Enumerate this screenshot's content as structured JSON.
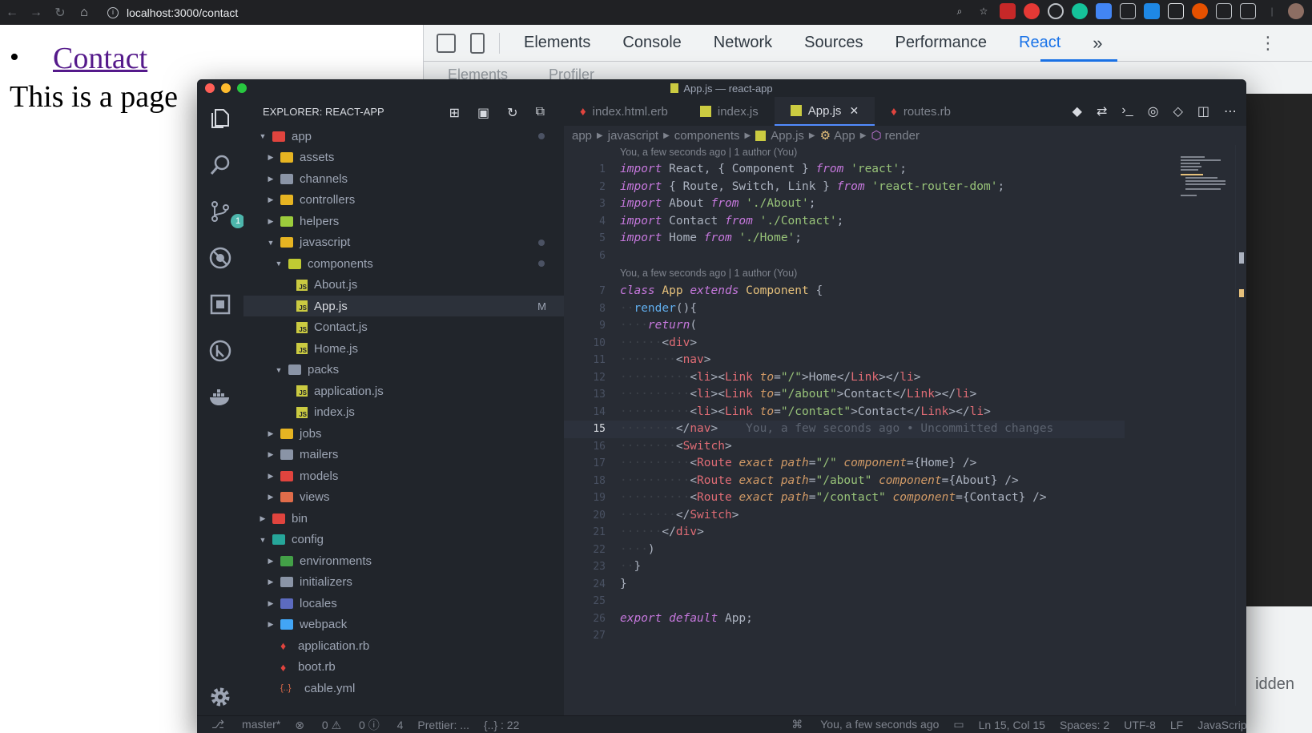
{
  "browser": {
    "url": "localhost:3000/contact"
  },
  "page": {
    "link_text": "Contact",
    "paragraph": "This is a page"
  },
  "devtools": {
    "tabs": [
      "Elements",
      "Console",
      "Network",
      "Sources",
      "Performance",
      "React"
    ],
    "more": "»",
    "subtabs": [
      "Elements",
      "Profiler"
    ],
    "hidden_label": "idden"
  },
  "vscode": {
    "title": "App.js — react-app",
    "explorer_title": "EXPLORER: REACT-APP",
    "scm_badge": "1",
    "tree": [
      {
        "label": "app",
        "depth": 0,
        "arrow": "▼",
        "kind": "folder",
        "color": "#e0443e",
        "dot": true
      },
      {
        "label": "assets",
        "depth": 1,
        "arrow": "▶",
        "kind": "folder",
        "color": "#e6b422"
      },
      {
        "label": "channels",
        "depth": 1,
        "arrow": "▶",
        "kind": "folder",
        "color": "#8a94a6"
      },
      {
        "label": "controllers",
        "depth": 1,
        "arrow": "▶",
        "kind": "folder",
        "color": "#e6b422"
      },
      {
        "label": "helpers",
        "depth": 1,
        "arrow": "▶",
        "kind": "folder",
        "color": "#9ccc3c"
      },
      {
        "label": "javascript",
        "depth": 1,
        "arrow": "▼",
        "kind": "folder",
        "color": "#e6b422",
        "dot": true
      },
      {
        "label": "components",
        "depth": 2,
        "arrow": "▼",
        "kind": "folder",
        "color": "#c0ca33",
        "dot": true
      },
      {
        "label": "About.js",
        "depth": 3,
        "arrow": "",
        "kind": "js"
      },
      {
        "label": "App.js",
        "depth": 3,
        "arrow": "",
        "kind": "js",
        "selected": true,
        "mod": "M"
      },
      {
        "label": "Contact.js",
        "depth": 3,
        "arrow": "",
        "kind": "js"
      },
      {
        "label": "Home.js",
        "depth": 3,
        "arrow": "",
        "kind": "js"
      },
      {
        "label": "packs",
        "depth": 2,
        "arrow": "▼",
        "kind": "folder",
        "color": "#8a94a6"
      },
      {
        "label": "application.js",
        "depth": 3,
        "arrow": "",
        "kind": "js"
      },
      {
        "label": "index.js",
        "depth": 3,
        "arrow": "",
        "kind": "js"
      },
      {
        "label": "jobs",
        "depth": 1,
        "arrow": "▶",
        "kind": "folder",
        "color": "#e6b422"
      },
      {
        "label": "mailers",
        "depth": 1,
        "arrow": "▶",
        "kind": "folder",
        "color": "#8a94a6"
      },
      {
        "label": "models",
        "depth": 1,
        "arrow": "▶",
        "kind": "folder",
        "color": "#e0443e"
      },
      {
        "label": "views",
        "depth": 1,
        "arrow": "▶",
        "kind": "folder",
        "color": "#e06c4a"
      },
      {
        "label": "bin",
        "depth": 0,
        "arrow": "▶",
        "kind": "folder",
        "color": "#e0443e"
      },
      {
        "label": "config",
        "depth": 0,
        "arrow": "▼",
        "kind": "folder",
        "color": "#26a69a"
      },
      {
        "label": "environments",
        "depth": 1,
        "arrow": "▶",
        "kind": "folder",
        "color": "#43a047"
      },
      {
        "label": "initializers",
        "depth": 1,
        "arrow": "▶",
        "kind": "folder",
        "color": "#8a94a6"
      },
      {
        "label": "locales",
        "depth": 1,
        "arrow": "▶",
        "kind": "folder",
        "color": "#5c6bc0"
      },
      {
        "label": "webpack",
        "depth": 1,
        "arrow": "▶",
        "kind": "folder",
        "color": "#42a5f5"
      },
      {
        "label": "application.rb",
        "depth": 1,
        "arrow": "",
        "kind": "rb"
      },
      {
        "label": "boot.rb",
        "depth": 1,
        "arrow": "",
        "kind": "rb"
      },
      {
        "label": "cable.yml",
        "depth": 1,
        "arrow": "",
        "kind": "yml"
      }
    ],
    "tabs": [
      {
        "label": "index.html.erb",
        "kind": "rb"
      },
      {
        "label": "index.js",
        "kind": "js"
      },
      {
        "label": "App.js",
        "kind": "js",
        "active": true
      },
      {
        "label": "routes.rb",
        "kind": "rb"
      }
    ],
    "breadcrumbs": [
      "app",
      "javascript",
      "components",
      "App.js",
      "App",
      "render"
    ],
    "codelens_1": "You, a few seconds ago | 1 author (You)",
    "codelens_2": "You, a few seconds ago | 1 author (You)",
    "blame": "You, a few seconds ago • Uncommitted changes",
    "status": {
      "branch": "master*",
      "errors": "0",
      "warnings": "0",
      "info": "4",
      "prettier": "Prettier: ...",
      "braces": "{..} : 22",
      "blame": "You, a few seconds ago",
      "position": "Ln 15, Col 15",
      "spaces": "Spaces: 2",
      "encoding": "UTF-8",
      "eol": "LF",
      "language": "JavaScript"
    }
  }
}
